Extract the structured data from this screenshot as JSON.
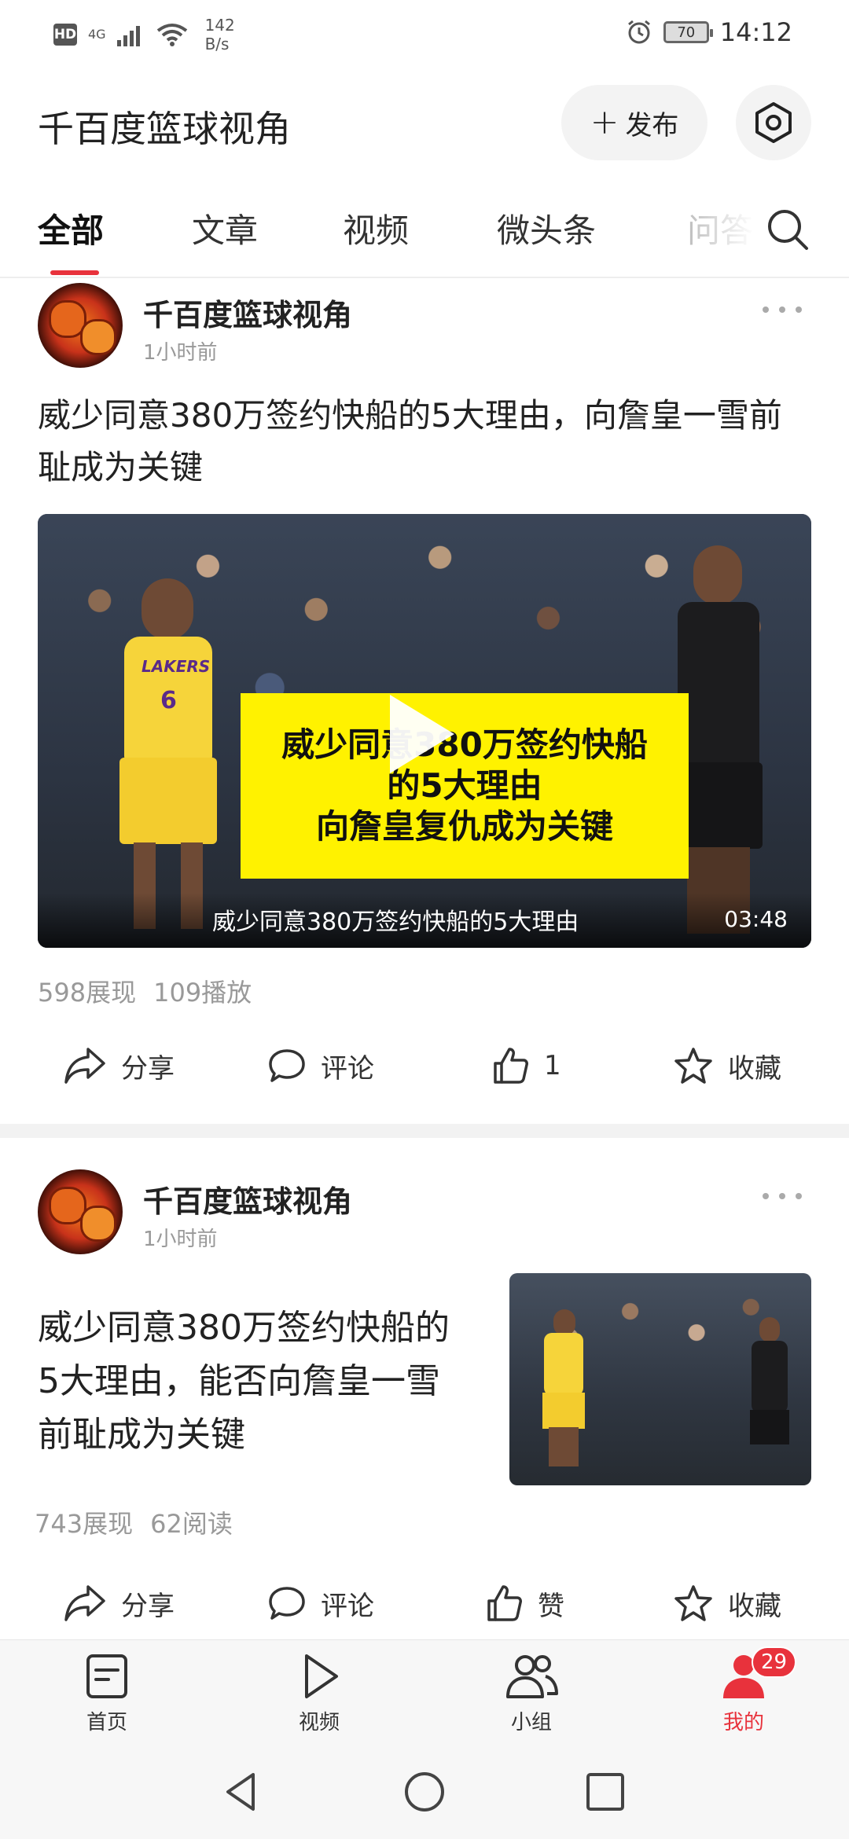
{
  "status_bar": {
    "hd": "HD",
    "network": "4G",
    "speed_value": "142",
    "speed_unit": "B/s",
    "battery": "70",
    "time": "14:12"
  },
  "header": {
    "title": "千百度篮球视角",
    "publish_label": "发布",
    "publish_icon": "+"
  },
  "tabs": [
    "全部",
    "文章",
    "视频",
    "微头条",
    "问答"
  ],
  "active_tab": "全部",
  "posts": [
    {
      "author": "千百度篮球视角",
      "time": "1小时前",
      "title": "威少同意380万签约快船的5大理由，向詹皇一雪前耻成为关键",
      "video": {
        "overlay_lines": [
          "威少同意380万签约快船",
          "的5大理由",
          "向詹皇复仇成为关键"
        ],
        "caption": "威少同意380万签约快船的5大理由",
        "duration": "03:48",
        "jersey_number": "6",
        "jersey_team": "LAKERS"
      },
      "stats": [
        "598展现",
        "109播放"
      ],
      "actions": {
        "share": "分享",
        "comment": "评论",
        "like": "1",
        "favorite": "收藏"
      }
    },
    {
      "author": "千百度篮球视角",
      "time": "1小时前",
      "title_lines": [
        "威少同意380万签约快船的",
        "5大理由，能否向詹皇一雪",
        "前耻成为关键"
      ],
      "stats": [
        "743展现",
        "62阅读"
      ],
      "actions": {
        "share": "分享",
        "comment": "评论",
        "like": "赞",
        "favorite": "收藏"
      }
    }
  ],
  "bottom_nav": {
    "items": [
      {
        "label": "首页",
        "icon": "home-icon"
      },
      {
        "label": "视频",
        "icon": "play-icon"
      },
      {
        "label": "小组",
        "icon": "group-icon"
      },
      {
        "label": "我的",
        "icon": "profile-icon"
      }
    ],
    "active": "我的",
    "badge": "29"
  },
  "colors": {
    "accent": "#e8323c",
    "overlay_yellow": "#fff200"
  }
}
